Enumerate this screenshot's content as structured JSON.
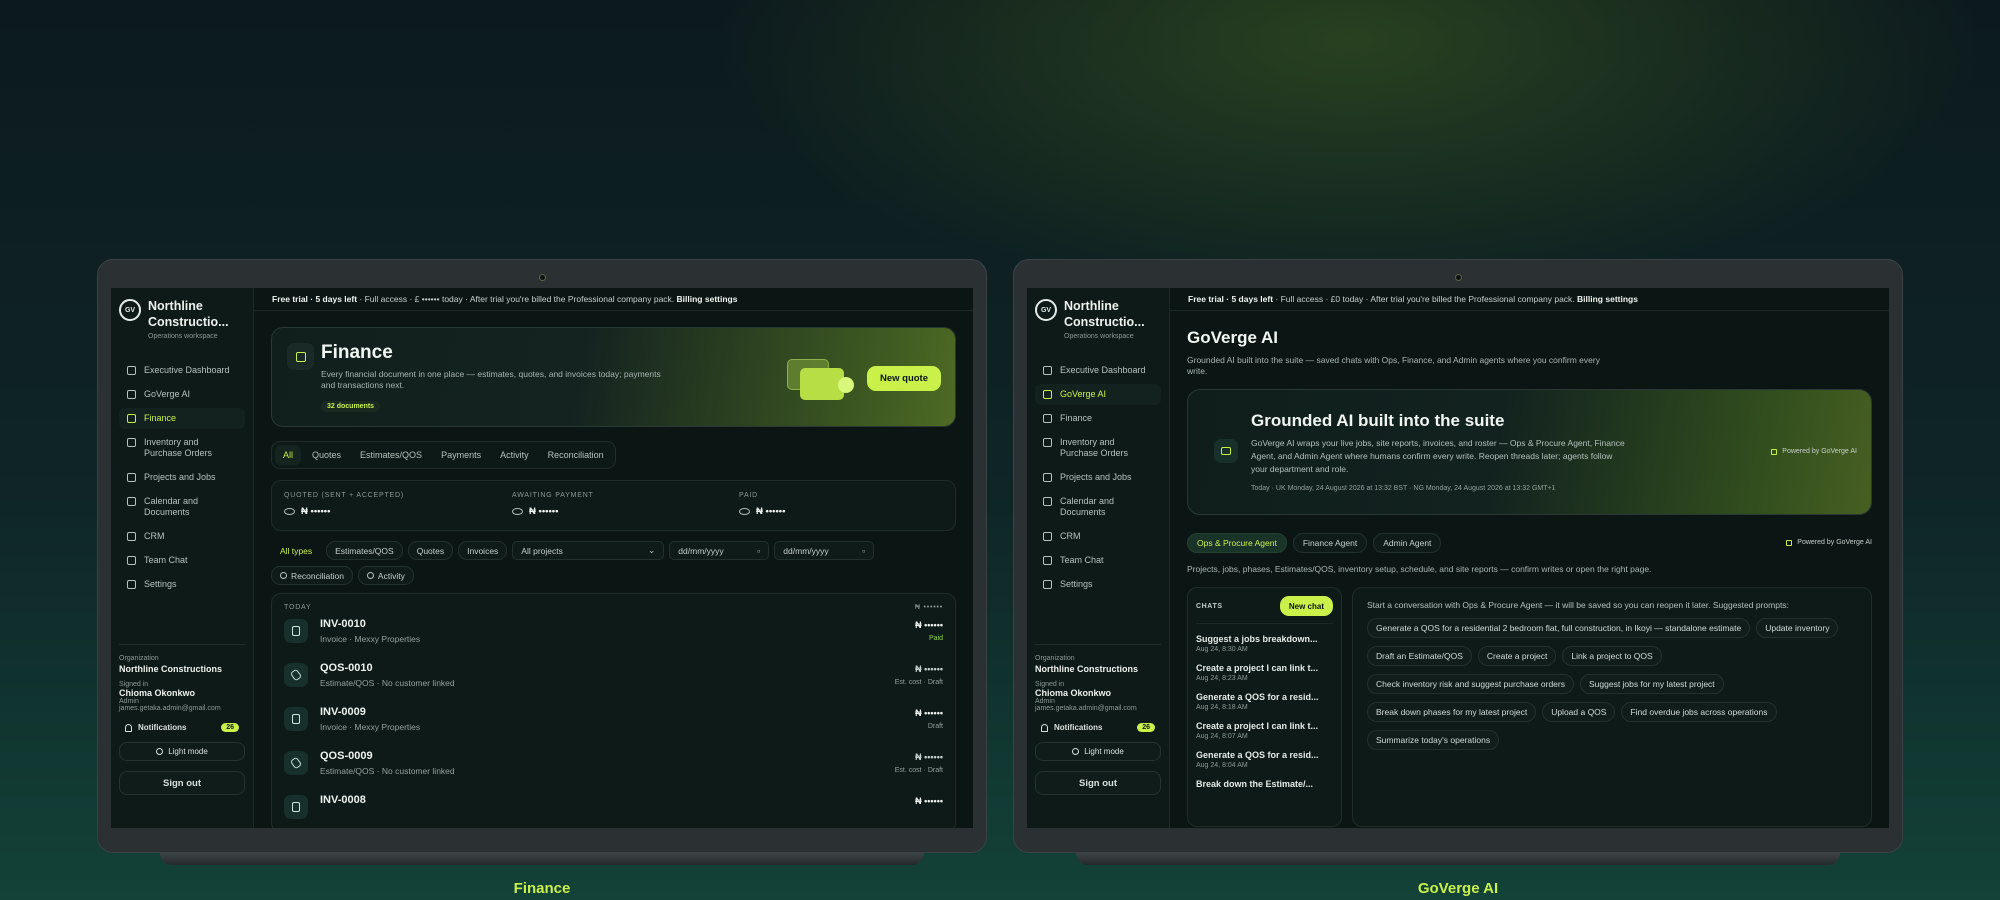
{
  "captions": {
    "left": "Finance",
    "right": "GoVerge AI"
  },
  "sidebar": {
    "logo": "GV",
    "brand_name": "Northline Constructio...",
    "brand_sub": "Operations workspace",
    "items": [
      {
        "label": "Executive Dashboard",
        "icon": "dashboard-icon"
      },
      {
        "label": "GoVerge AI",
        "icon": "bot-icon"
      },
      {
        "label": "Finance",
        "icon": "document-icon"
      },
      {
        "label": "Inventory and Purchase Orders",
        "icon": "box-icon"
      },
      {
        "label": "Projects and Jobs",
        "icon": "folder-icon"
      },
      {
        "label": "Calendar and Documents",
        "icon": "calendar-icon"
      },
      {
        "label": "CRM",
        "icon": "crm-icon"
      },
      {
        "label": "Team Chat",
        "icon": "chat-icon"
      },
      {
        "label": "Settings",
        "icon": "gear-icon"
      }
    ],
    "org_label": "Organization",
    "org_name": "Northline Constructions",
    "signed_label": "Signed in",
    "user_name": "Chioma Okonkwo",
    "user_role": "Admin",
    "user_email": "james.getaka.admin@gmail.com",
    "notifications_label": "Notifications",
    "notifications_count": "26",
    "light_mode": "Light mode",
    "sign_out": "Sign out"
  },
  "finance": {
    "trial": {
      "strong": "Free trial · 5 days left",
      "text": " · Full access · £ •••••• today · After trial you're billed the Professional company pack. ",
      "link": "Billing settings"
    },
    "title": "Finance",
    "description": "Every financial document in one place — estimates, quotes, and invoices today; payments and transactions next.",
    "doc_count": "32 documents",
    "new_quote": "New quote",
    "tabs": [
      "All",
      "Quotes",
      "Estimates/QOS",
      "Payments",
      "Activity",
      "Reconciliation"
    ],
    "summary": [
      {
        "label": "QUOTED (SENT + ACCEPTED)",
        "value": "₦ ••••••"
      },
      {
        "label": "AWAITING PAYMENT",
        "value": "₦ ••••••"
      },
      {
        "label": "PAID",
        "value": "₦ ••••••"
      }
    ],
    "filters": {
      "types": [
        "All types",
        "Estimates/QOS",
        "Quotes",
        "Invoices"
      ],
      "project_select": "All projects",
      "date_from": "dd/mm/yyyy",
      "date_to": "dd/mm/yyyy",
      "extra": [
        "Reconciliation",
        "Activity"
      ]
    },
    "list_head": "TODAY",
    "list_total": "₦ ••••••",
    "rows": [
      {
        "id": "INV-0010",
        "sub": "Invoice · Mexxy Properties",
        "amount": "₦ ••••••",
        "status": "Paid",
        "kind": "invoice"
      },
      {
        "id": "QOS-0010",
        "sub": "Estimate/QOS · No customer linked",
        "amount": "₦ ••••••",
        "status": "Est. cost · Draft",
        "kind": "estimate"
      },
      {
        "id": "INV-0009",
        "sub": "Invoice · Mexxy Properties",
        "amount": "₦ ••••••",
        "status": "Draft",
        "kind": "invoice"
      },
      {
        "id": "QOS-0009",
        "sub": "Estimate/QOS · No customer linked",
        "amount": "₦ ••••••",
        "status": "Est. cost · Draft",
        "kind": "estimate"
      },
      {
        "id": "INV-0008",
        "sub": "",
        "amount": "₦ ••••••",
        "status": "",
        "kind": "invoice"
      }
    ]
  },
  "ai": {
    "trial": {
      "strong": "Free trial · 5 days left",
      "text": " · Full access · £0 today · After trial you're billed the Professional company pack. ",
      "link": "Billing settings"
    },
    "title": "GoVerge AI",
    "description": "Grounded AI built into the suite — saved chats with Ops, Finance, and Admin agents where you confirm every write.",
    "hero_title": "Grounded AI built into the suite",
    "hero_desc": "GoVerge AI wraps your live jobs, site reports, invoices, and roster — Ops & Procure Agent, Finance Agent, and Admin Agent where humans confirm every write. Reopen threads later; agents follow your department and role.",
    "hero_date": "Today · UK Monday, 24 August 2026 at 13:32 BST · NG Monday, 24 August 2026 at 13:32 GMT+1",
    "powered": "Powered by GoVerge AI",
    "agents": [
      "Ops & Procure Agent",
      "Finance Agent",
      "Admin Agent"
    ],
    "scope_line": "Projects, jobs, phases, Estimates/QOS, inventory setup, schedule, and site reports — confirm writes or open the right page.",
    "chats_label": "CHATS",
    "new_chat": "New chat",
    "chats": [
      {
        "title": "Suggest a jobs breakdown...",
        "date": "Aug 24, 8:30 AM"
      },
      {
        "title": "Create a project I can link t...",
        "date": "Aug 24, 8:23 AM"
      },
      {
        "title": "Generate a QOS for a resid...",
        "date": "Aug 24, 8:18 AM"
      },
      {
        "title": "Create a project I can link t...",
        "date": "Aug 24, 8:07 AM"
      },
      {
        "title": "Generate a QOS for a resid...",
        "date": "Aug 24, 8:04 AM"
      },
      {
        "title": "Break down the Estimate/...",
        "date": ""
      }
    ],
    "intro": "Start a conversation with Ops & Procure Agent — it will be saved so you can reopen it later. Suggested prompts:",
    "prompts": [
      "Generate a QOS for a residential 2 bedroom flat, full construction, in Ikoyi — standalone estimate",
      "Update inventory",
      "Draft an Estimate/QOS",
      "Create a project",
      "Link a project to QOS",
      "Check inventory risk and suggest purchase orders",
      "Suggest jobs for my latest project",
      "Break down phases for my latest project",
      "Upload a QOS",
      "Find overdue jobs across operations",
      "Summarize today's operations"
    ]
  }
}
